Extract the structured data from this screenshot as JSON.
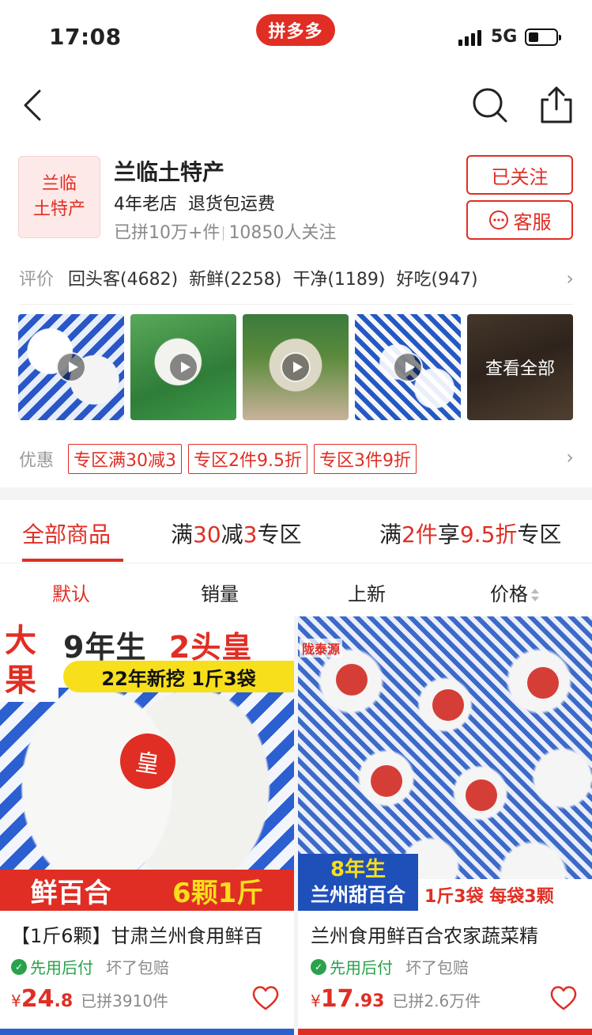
{
  "status_bar": {
    "time": "17:08",
    "network": "5G",
    "brand": "拼多多"
  },
  "store": {
    "logo_line1": "兰临",
    "logo_line2": "土特产",
    "name": "兰临土特产",
    "meta1": "4年老店",
    "meta2": "退货包运费",
    "sold": "已拼10万+件",
    "followers": "10850人关注",
    "follow_label": "已关注",
    "service_label": "客服"
  },
  "reviews": {
    "label": "评价",
    "tags": [
      "回头客(4682)",
      "新鲜(2258)",
      "干净(1189)",
      "好吃(947)"
    ]
  },
  "media": {
    "view_all": "查看全部"
  },
  "coupons": {
    "label": "优惠",
    "items": [
      "专区满30减3",
      "专区2件9.5折",
      "专区3件9折"
    ]
  },
  "category_tabs": {
    "tab1": "全部商品",
    "tab2": {
      "p1": "满",
      "h1": "30",
      "p2": "减",
      "h2": "3",
      "p3": "专区"
    },
    "tab3": {
      "p1": "满",
      "h1": "2件",
      "p2": "享",
      "h2": "9.5折",
      "p3": "专区"
    }
  },
  "sort": {
    "default": "默认",
    "sales": "销量",
    "new": "上新",
    "price": "价格"
  },
  "products": [
    {
      "image_text": {
        "big1": "大",
        "big2": "果",
        "line1_a": "9年生",
        "line1_b": "2头皇",
        "line2": "22年新挖 1斤3袋",
        "seal": "皇",
        "bottom_a": "鲜百合",
        "bottom_b": "6颗1斤"
      },
      "title": "【1斤6颗】甘肃兰州食用鲜百",
      "prepay": "先用后付",
      "guarantee": "坏了包赔",
      "currency": "¥",
      "price_int": "24",
      "price_dec": ".8",
      "sold": "已拼3910件"
    },
    {
      "image_text": {
        "brand": "陇泰源",
        "badge_a": "8年生",
        "badge_b": "兰州甜百合",
        "strip": "1斤3袋 每袋3颗"
      },
      "title": "兰州食用鲜百合农家蔬菜精",
      "prepay": "先用后付",
      "guarantee": "坏了包赔",
      "currency": "¥",
      "price_int": "17",
      "price_dec": ".93",
      "sold": "已拼2.6万件"
    }
  ],
  "colors": {
    "accent": "#e02e24",
    "green": "#2aa24c",
    "muted": "#8a8a8a"
  }
}
